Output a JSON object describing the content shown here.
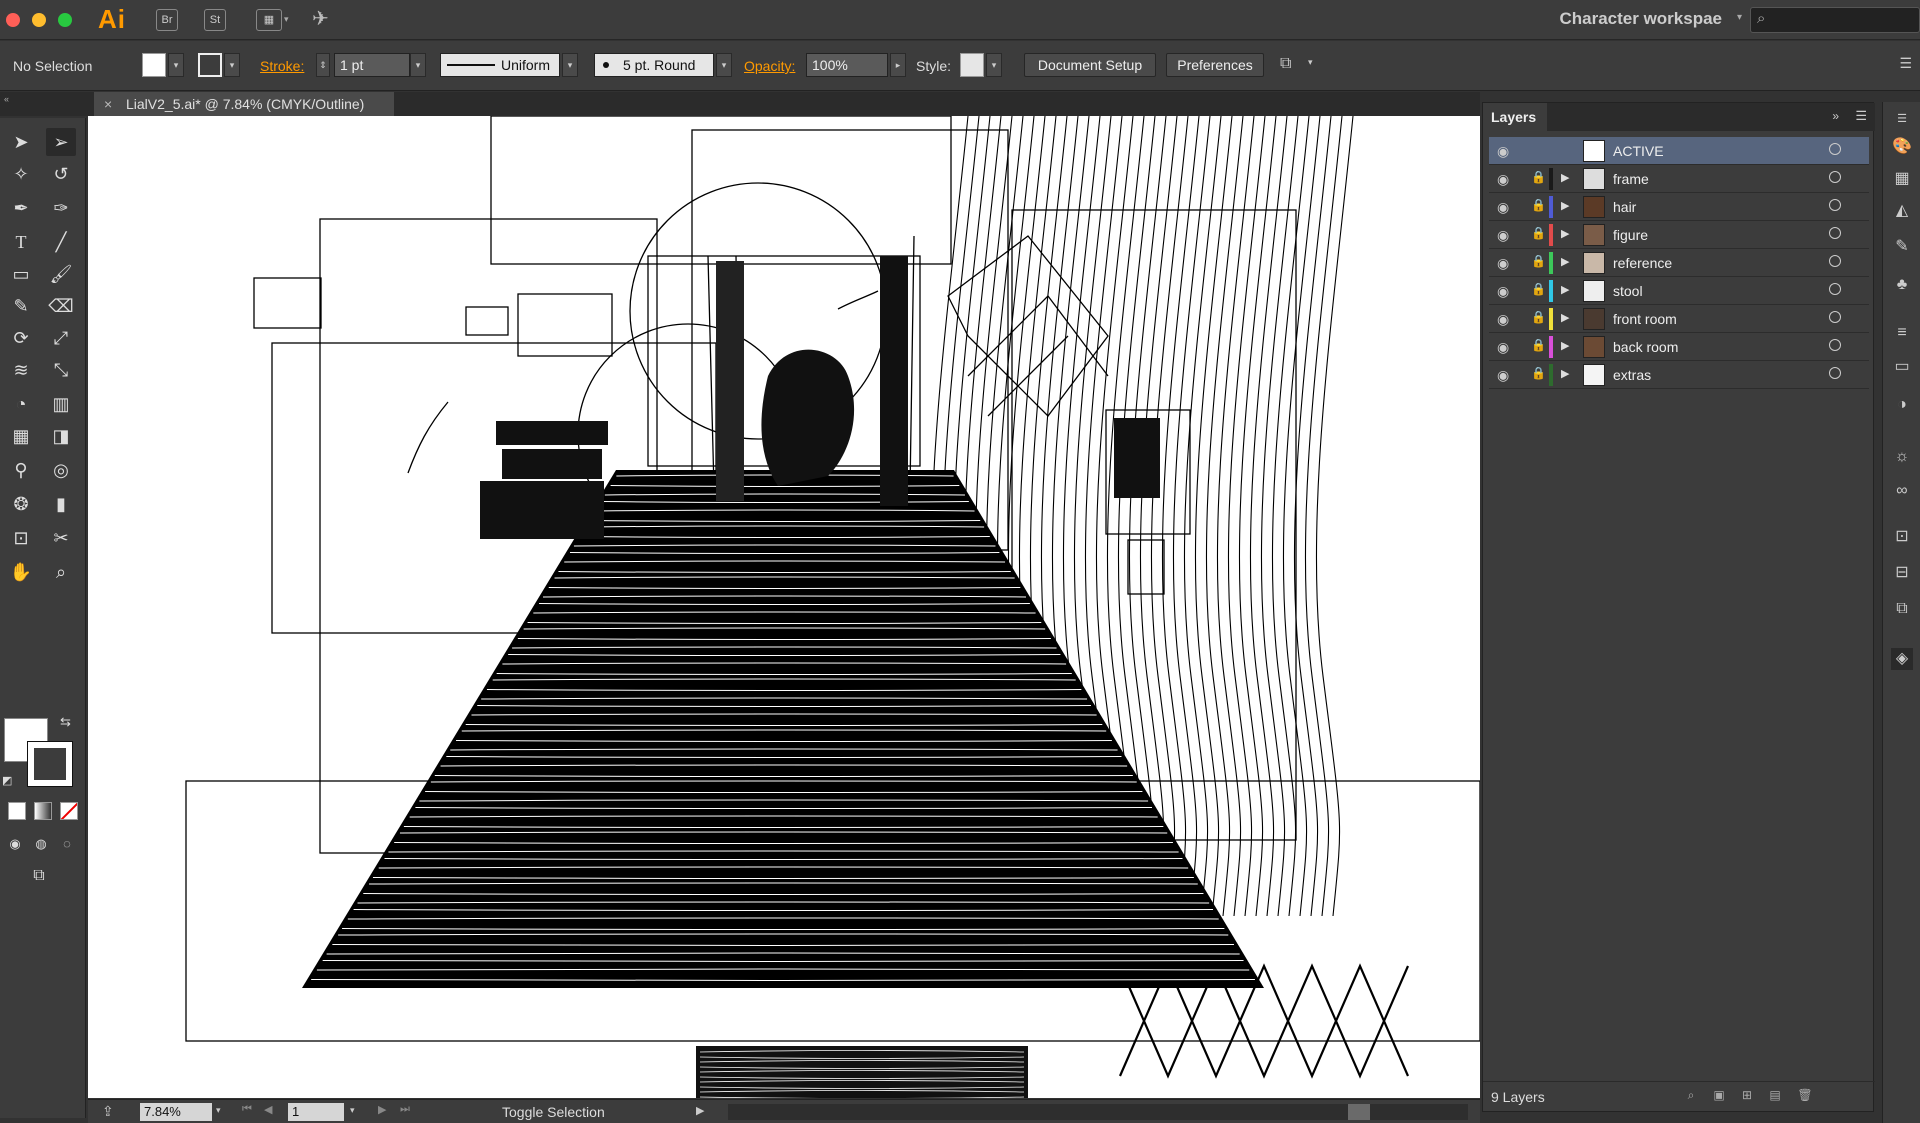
{
  "app": {
    "logo": "Ai",
    "bridge_label": "Br",
    "stock_label": "St",
    "workspace": "Character workspae"
  },
  "traffic": {
    "close": "#ff5f57",
    "minimize": "#ffbd2e",
    "maximize": "#28c940"
  },
  "control": {
    "selection": "No Selection",
    "stroke_label": "Stroke:",
    "stroke_value": "1 pt",
    "profile": "Uniform",
    "brush": "5 pt. Round",
    "opacity_label": "Opacity:",
    "opacity_value": "100%",
    "style_label": "Style:",
    "doc_setup": "Document Setup",
    "preferences": "Preferences"
  },
  "document": {
    "tab_title": "LialV2_5.ai* @ 7.84% (CMYK/Outline)",
    "close": "×"
  },
  "status": {
    "zoom": "7.84%",
    "page": "1",
    "text": "Toggle Selection"
  },
  "layers": {
    "title": "Layers",
    "count": "9 Layers",
    "items": [
      {
        "name": "ACTIVE",
        "color": "#57657e",
        "active": true
      },
      {
        "name": "frame",
        "color": "#1a1a1a"
      },
      {
        "name": "hair",
        "color": "#4f5bd5"
      },
      {
        "name": "figure",
        "color": "#e14b4b"
      },
      {
        "name": "reference",
        "color": "#3cc85a"
      },
      {
        "name": "stool",
        "color": "#30c8e6"
      },
      {
        "name": "front room",
        "color": "#f0e03a"
      },
      {
        "name": "back room",
        "color": "#d94fd9"
      },
      {
        "name": "extras",
        "color": "#2e6b2e"
      }
    ]
  },
  "icons": {
    "selection": "arrow-icon",
    "direct": "direct-selection-icon",
    "wand": "magic-wand-icon",
    "lasso": "lasso-icon",
    "pen": "pen-icon",
    "type": "type-icon",
    "line": "line-icon",
    "rect": "rectangle-icon",
    "brush": "paintbrush-icon",
    "eraser": "eraser-icon",
    "rotate": "rotate-icon",
    "scale": "scale-icon",
    "hand": "hand-icon",
    "zoom": "zoom-icon"
  }
}
